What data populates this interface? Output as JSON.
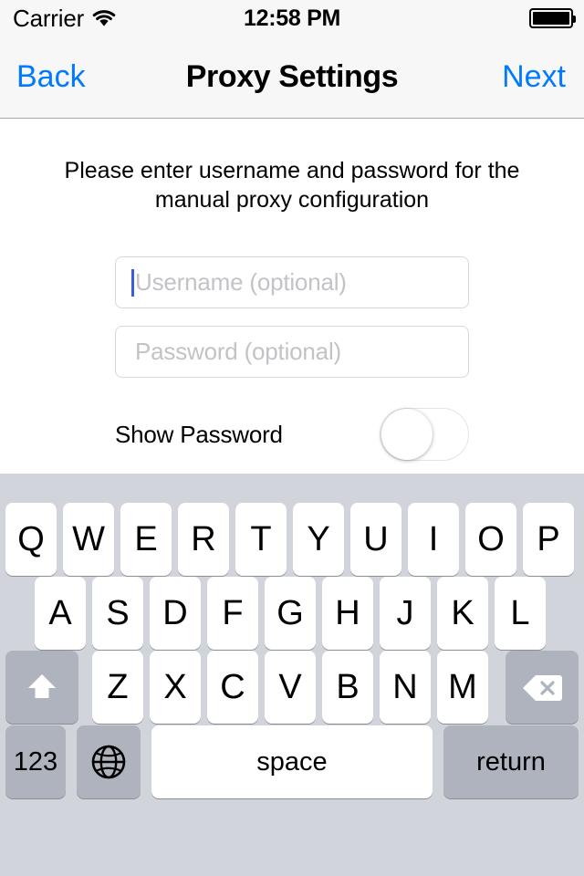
{
  "status_bar": {
    "carrier": "Carrier",
    "wifi_icon": "wifi-icon",
    "time": "12:58 PM",
    "battery_icon": "battery-full-icon"
  },
  "nav_bar": {
    "back_label": "Back",
    "title": "Proxy Settings",
    "next_label": "Next",
    "tint_color": "#007aff"
  },
  "content": {
    "instruction": "Please enter username and password for the manual proxy configuration",
    "username": {
      "value": "",
      "placeholder": "Username (optional)",
      "focused": true,
      "caret_color": "#3b5ce0"
    },
    "password": {
      "value": "",
      "placeholder": "Password (optional)",
      "focused": false
    },
    "show_password": {
      "label": "Show Password",
      "state": "off"
    }
  },
  "keyboard": {
    "row1": [
      "Q",
      "W",
      "E",
      "R",
      "T",
      "Y",
      "U",
      "I",
      "O",
      "P"
    ],
    "row2": [
      "A",
      "S",
      "D",
      "F",
      "G",
      "H",
      "J",
      "K",
      "L"
    ],
    "row3": [
      "Z",
      "X",
      "C",
      "V",
      "B",
      "N",
      "M"
    ],
    "shift_icon": "shift-up-arrow-icon",
    "delete_icon": "backspace-delete-icon",
    "numeric_label": "123",
    "globe_icon": "globe-language-icon",
    "space_label": "space",
    "return_label": "return",
    "background_color": "#d1d5db",
    "key_color": "#ffffff",
    "modifier_key_color": "#aeb3bd"
  }
}
